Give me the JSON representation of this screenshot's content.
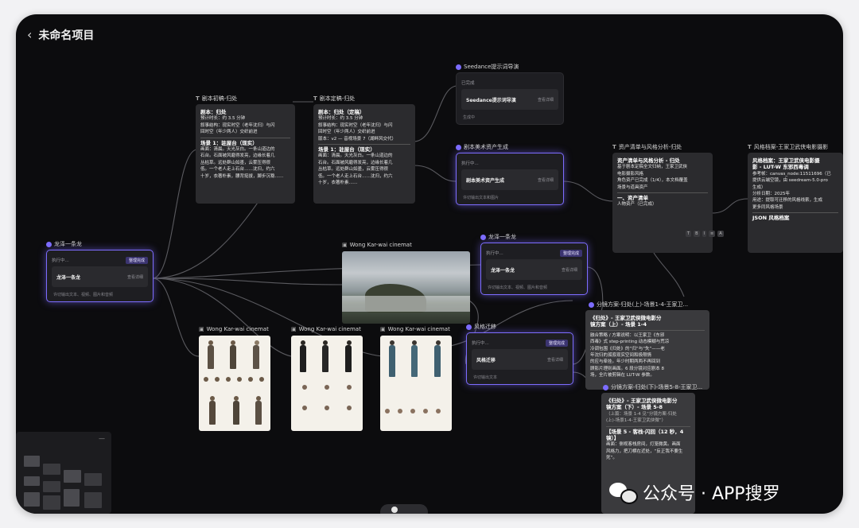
{
  "header": {
    "back_icon": "chevron-left-icon",
    "title": "未命名项目"
  },
  "colors": {
    "accent": "#7d6cff",
    "canvas": "#0c0c0e",
    "card": "#2b2b2e"
  },
  "nodes": {
    "source": {
      "title": "龙泽一条龙",
      "exec": "执行中...",
      "badge": "整理完成",
      "label": "龙泽一条龙",
      "action": "查看详细",
      "footer": "许切输出文本、视频、图片和音频"
    },
    "script1": {
      "title": "剧本初稿-归处",
      "lines": [
        "剧本：归处",
        "预计时长：约 3.5 分钟",
        "叙事结构：现实时空（老年沈归）与闪",
        "回时空（年少两人）交织前进",
        "场景 1：驻屋台（现实）",
        "画面：清晨。天光灰白。一条山道边的",
        "石台。石面被风磨得发亮，边缘长着几",
        "丛枯草。远处群山如墨，云雾压得很",
        "低。一个老人走上石台……沈归，约六",
        "十岁，衣著朴素，腰背挺拔，脚步沉稳……"
      ]
    },
    "script2": {
      "title": "剧本定稿-归处",
      "lines": [
        "剧本：归处（定稿）",
        "预计时长：约 3.5 分钟",
        "叙事结构：现实时空（老年沈归）与闪",
        "回时空（年少两人）交织前进",
        "版本：v2 — 音视场景 7（湖畔风交代）",
        "场景 1：驻屋台（现实）",
        "画面：清晨。天光灰白。一条山道边的",
        "石台。石面被风磨得发亮，边缘长着几",
        "丛枯草。远处群山如墨，云雾压得很",
        "低。一个老人走上石台……沈归，约六",
        "十岁，衣著朴素……"
      ]
    },
    "seedance": {
      "title": "Seedance提示词导演",
      "exec": "已完成",
      "label": "Seedance提示词导演",
      "action": "查看详细",
      "footer": "生成中"
    },
    "art": {
      "title": "剧本美术资产生成",
      "exec": "执行中...",
      "label": "剧本美术资产生成",
      "action": "查看详细",
      "footer": "许切输出文本和图片"
    },
    "assets": {
      "title": "资产清单与风格分析-归处",
      "lines": [
        "资产清单与风格分析 - 归处",
        "基于剧本定稿全文归纳，王家卫武侠",
        "电影摄影风格",
        "角色资产已完成（1/4），本文档覆盖",
        "场景与道具资产",
        "一、资产清单",
        "人物资产（已完成）"
      ],
      "toolbar": [
        "T",
        "B",
        "I",
        "≡",
        "A"
      ]
    },
    "style": {
      "title": "风格档案-王家卫武侠电影摄影",
      "lines": [
        "风格档案：王家卫武侠电影摄",
        "影 - LUT-W 东邪西毒调",
        "参考帧：canvas_node:11511696（已",
        "提供云端空镜，由 seedream-5.0-pro",
        "生成）",
        "分析日期：2025年",
        "用途：提取可迁移的风格线索，生成",
        "更多同风格场景",
        "JSON 风格档案"
      ]
    },
    "landscape": {
      "title": "Wong Kar-wai cinemat"
    },
    "dragon2": {
      "title": "龙泽一条龙",
      "exec": "执行中...",
      "badge": "整理完成",
      "label": "龙泽一条龙",
      "action": "查看详细",
      "footer": "许切输出文本、视频、图片和音频"
    },
    "sheets": [
      {
        "title": "Wong Kar-wai cinemat"
      },
      {
        "title": "Wong Kar-wai cinemat"
      },
      {
        "title": "Wong Kar-wai cinemat"
      }
    ],
    "migrate": {
      "title": "风格迁移",
      "exec": "执行中...",
      "badge": "整理完成",
      "label": "风格迁移",
      "action": "查看详细",
      "footer": "许切输出文本"
    },
    "shot1": {
      "title": "分镜方案-归处(上)-场景1-4-王家卫...",
      "lines": [
        "《归处》- 王家卫武侠微电影分",
        "镜方案（上）- 场景 1-4",
        "融合策略 / 方案说明：以王家卫《东邪",
        "西毒》式 step-printing 动态模糊与荒凉",
        "冷调包围《归处》的“归”与“失”——老",
        "年沈归的孤寂现实空间和极限情",
        "的应与牵挂。年少时期两两不再回到",
        "顾影片理则画面。6 段分镜对应剧本 8",
        "场，全片被剪辑在 LUT-W 参数。"
      ]
    },
    "shot2": {
      "title": "分镜方案-归处(下)-场景5-8-王家卫...",
      "lines": [
        "《归处》- 王家卫武侠微电影分",
        "镜方案（下）- 场景 5-8",
        "（上篇：场景 1-4 见“分镜方案-归处",
        "(上)-场景1-4-王家卫武侠微”）",
        "【场景 5 - 客栈·闪回（12 秒，4",
        "镜）】",
        "画面：侧视客栈房间，灯笼微黄。画面",
        "风格力，把刀横在近处，“反正我不要生",
        "死”。"
      ]
    }
  },
  "minimap": {
    "close_icon": "minimize-icon"
  },
  "watermark": {
    "icon": "wechat-icon",
    "text": "公众号 · APP搜罗"
  }
}
